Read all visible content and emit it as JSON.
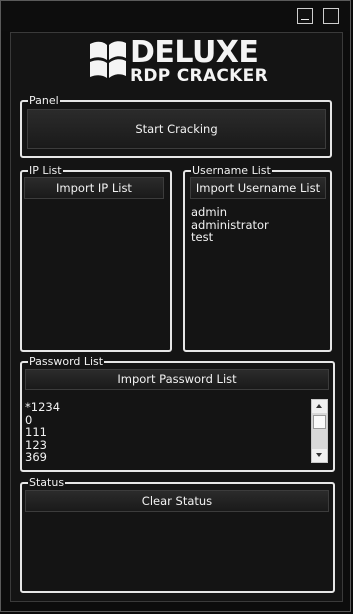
{
  "app": {
    "logo_line1": "DELUXE",
    "logo_line2": "RDP CRACKER"
  },
  "panel": {
    "legend": "Panel",
    "start_button": "Start Cracking"
  },
  "ip_list": {
    "legend": "IP List",
    "import_button": "Import IP List"
  },
  "username_list": {
    "legend": "Username List",
    "import_button": "Import Username List",
    "items": [
      "admin",
      "administrator",
      "test"
    ]
  },
  "password_list": {
    "legend": "Password List",
    "import_button": "Import Password List",
    "items": [
      "*1234",
      "0",
      "111",
      "123",
      "369"
    ]
  },
  "status": {
    "legend": "Status",
    "clear_button": "Clear Status"
  },
  "colors": {
    "background": "#0c0c0c",
    "border": "#e6e6e6",
    "text": "#f2f2f2"
  }
}
